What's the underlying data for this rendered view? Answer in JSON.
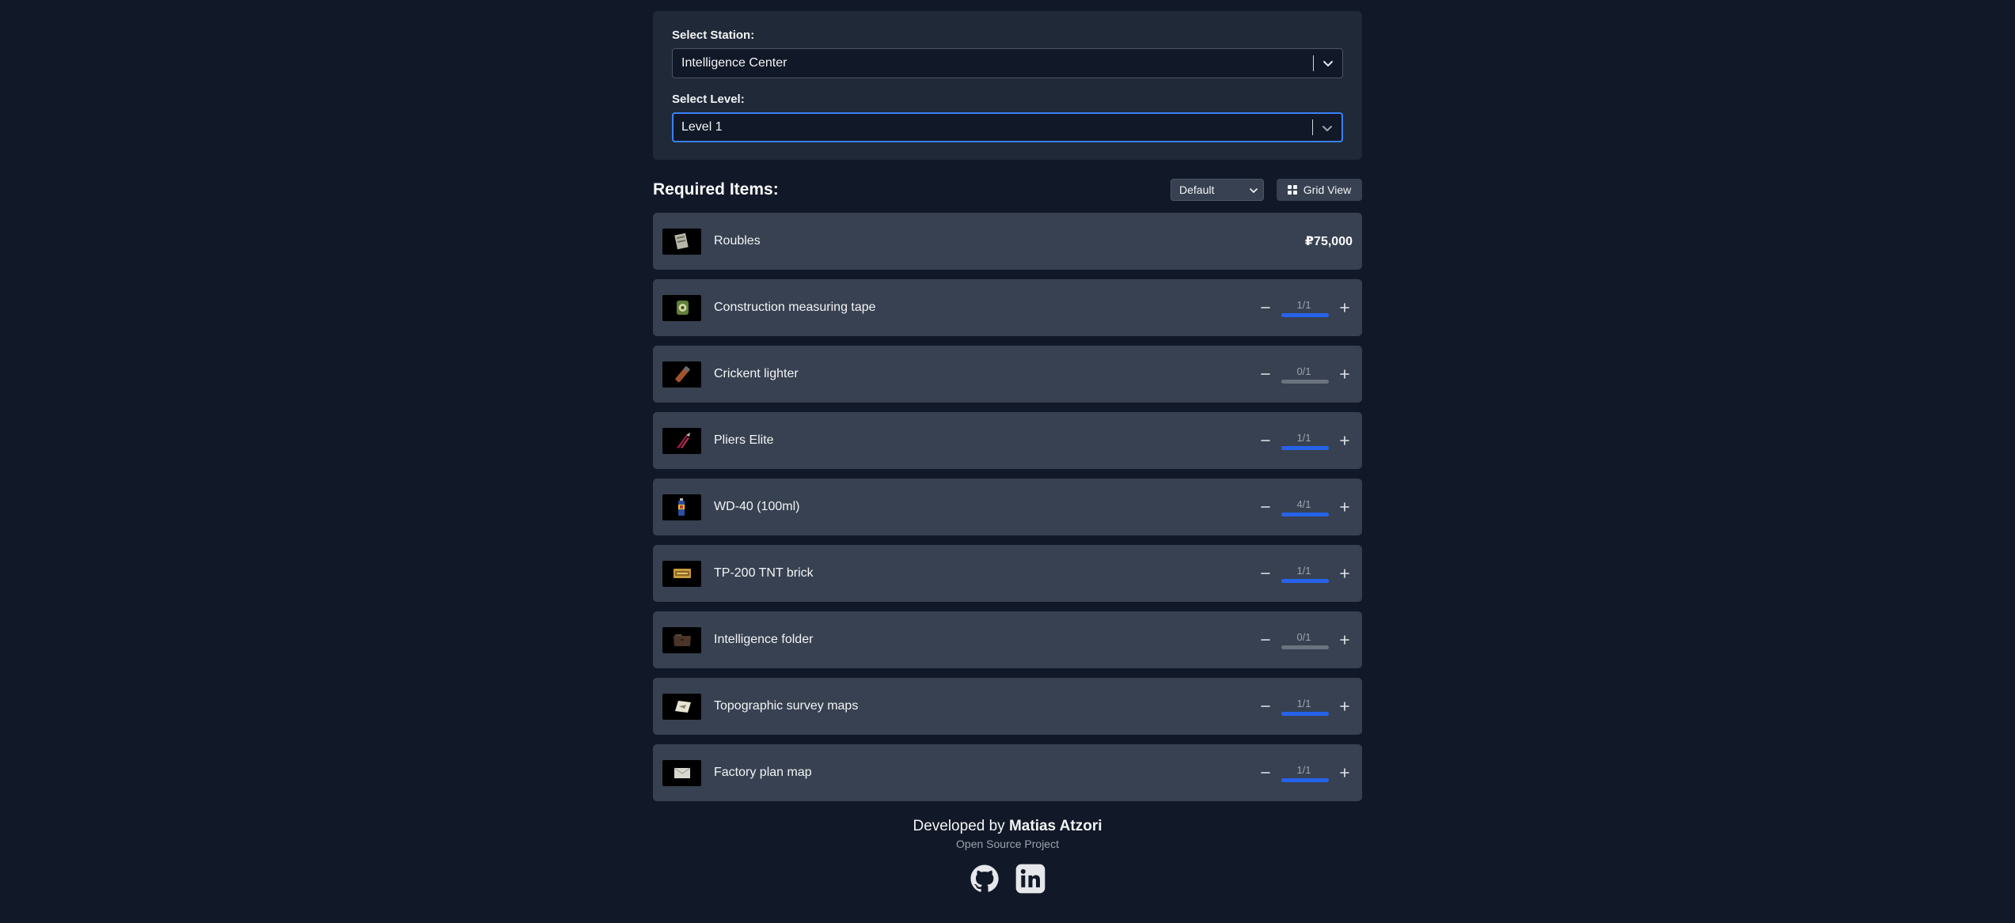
{
  "station": {
    "label": "Select Station:",
    "value": "Intelligence Center"
  },
  "level": {
    "label": "Select Level:",
    "value": "Level 1"
  },
  "items_section": {
    "title": "Required Items:",
    "sort_value": "Default",
    "view_button_label": "Grid View"
  },
  "roubles": {
    "name": "Roubles",
    "price": "₽75,000"
  },
  "items": [
    {
      "name": "Construction measuring tape",
      "count": "1/1",
      "progress": 1.0
    },
    {
      "name": "Crickent lighter",
      "count": "0/1",
      "progress": 0.0
    },
    {
      "name": "Pliers Elite",
      "count": "1/1",
      "progress": 1.0
    },
    {
      "name": "WD-40 (100ml)",
      "count": "4/1",
      "progress": 1.0
    },
    {
      "name": "TP-200 TNT brick",
      "count": "1/1",
      "progress": 1.0
    },
    {
      "name": "Intelligence folder",
      "count": "0/1",
      "progress": 0.0
    },
    {
      "name": "Topographic survey maps",
      "count": "1/1",
      "progress": 1.0
    },
    {
      "name": "Factory plan map",
      "count": "1/1",
      "progress": 1.0
    }
  ],
  "footer": {
    "developed_by": "Developed by",
    "author": "Matias Atzori",
    "subtitle": "Open Source Project"
  },
  "colors": {
    "background": "#111827",
    "panel": "#1f2937",
    "row": "#374151",
    "accent": "#2563eb",
    "empty_bar": "#6b7280"
  },
  "icons": {
    "social": [
      "github-icon",
      "linkedin-icon"
    ],
    "view_button": "grid-icon"
  }
}
